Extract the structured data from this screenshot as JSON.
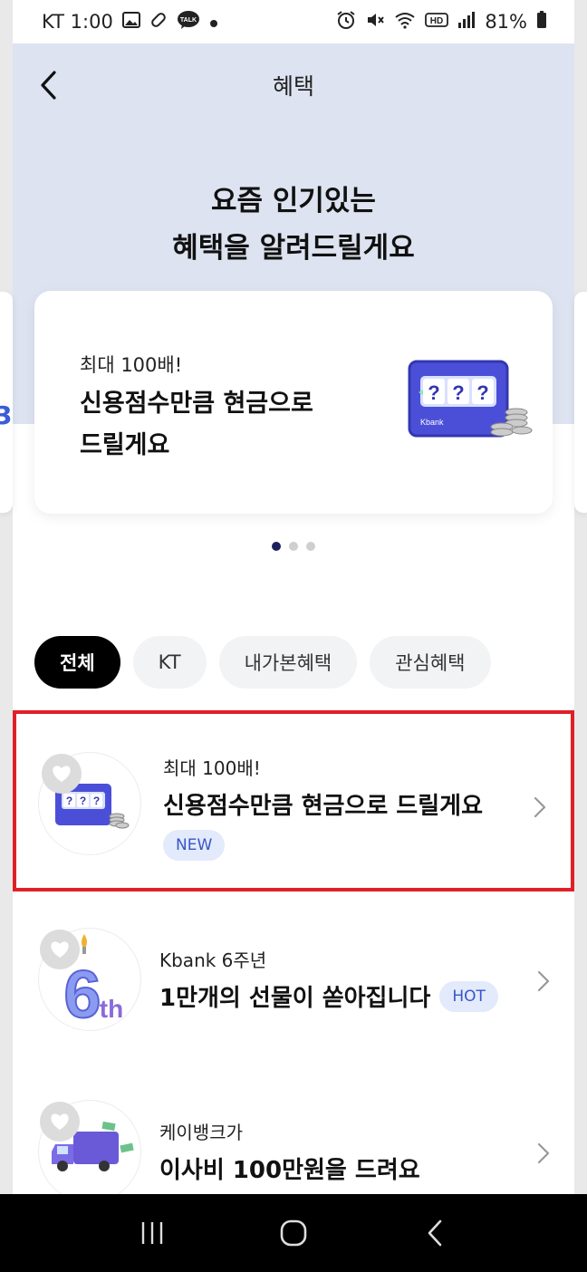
{
  "status_bar": {
    "carrier_time": "KT 1:00",
    "battery": "81%",
    "icons": [
      "gallery-icon",
      "pill-icon",
      "kakaotalk-icon",
      "dot-icon",
      "alarm-icon",
      "mute-icon",
      "wifi-icon",
      "hd-icon",
      "signal-icon",
      "battery-icon"
    ],
    "talk_label": "TALK",
    "hd_label": "HD"
  },
  "header": {
    "title": "혜택",
    "back_icon": "chevron-left-icon"
  },
  "hero": {
    "line1": "요즘 인기있는",
    "line2": "혜택을 알려드릴게요"
  },
  "carousel": {
    "banner": {
      "subtitle": "최대 100배!",
      "title_line1": "신용점수만큼 현금으로",
      "title_line2": "드릴게요",
      "art": "slot-machine-illustration",
      "art_brand": "Kbank"
    },
    "page_count": 3,
    "active_index": 0
  },
  "filters": [
    {
      "label": "전체",
      "active": true
    },
    {
      "label": "KT",
      "active": false
    },
    {
      "label": "내가본혜택",
      "active": false
    },
    {
      "label": "관심혜택",
      "active": false
    }
  ],
  "benefits": [
    {
      "subtitle": "최대 100배!",
      "title": "신용점수만큼 현금으로 드릴게요",
      "badge": "NEW",
      "thumb": "slot-machine-illustration",
      "selected": true
    },
    {
      "subtitle": "Kbank 6주년",
      "title": "1만개의 선물이 쏟아집니다",
      "badge": "HOT",
      "thumb": "6th-candle-illustration",
      "thumb_text_big": "6",
      "thumb_text_small": "th",
      "selected": false
    },
    {
      "subtitle": "케이뱅크가",
      "title": "이사비 100만원을 드려요",
      "badge": "",
      "thumb": "moving-truck-illustration",
      "selected": false
    }
  ],
  "navbar": {
    "icons": [
      "recent-apps-icon",
      "home-icon",
      "back-icon"
    ]
  },
  "colors": {
    "hero_bg": "#dde3f0",
    "badge_bg": "#e3eafb",
    "badge_text": "#3756c8",
    "highlight": "#e02027",
    "active_dot": "#1b1f5c"
  }
}
